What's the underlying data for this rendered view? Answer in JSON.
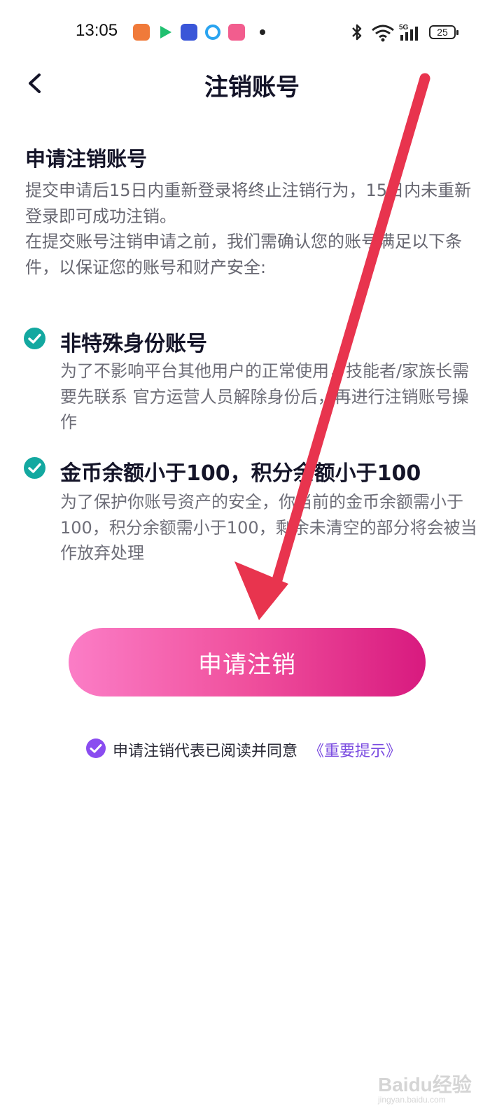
{
  "status_bar": {
    "time": "13:05",
    "app_icons": [
      {
        "name": "game-icon",
        "color": "#f07a3a"
      },
      {
        "name": "video-play-icon",
        "color": "#20c070"
      },
      {
        "name": "finance-app-icon",
        "color": "#3a56d8"
      },
      {
        "name": "browser-app-icon",
        "color": "#2aa4f0"
      },
      {
        "name": "bilibili-icon",
        "color": "#f25d8e"
      }
    ],
    "network": "5G",
    "battery": "25"
  },
  "nav": {
    "title": "注销账号"
  },
  "intro": {
    "heading": "申请注销账号",
    "paragraph_1": "提交申请后15日内重新登录将终止注销行为，15日内未重新登录即可成功注销。",
    "paragraph_2": "在提交账号注销申请之前，我们需确认您的账号满足以下条件，以保证您的账号和财产安全:"
  },
  "conditions": [
    {
      "title": "非特殊身份账号",
      "description": "为了不影响平台其他用户的正常使用，技能者/家族长需要先联系 官方运营人员解除身份后，再进行注销账号操作"
    },
    {
      "title": "金币余额小于100，积分余额小于100",
      "description": "为了保护你账号资产的安全，你当前的金币余额需小于100，积分余额需小于100，剩余未清空的部分将会被当作放弃处理"
    }
  ],
  "primary_action": {
    "label": "申请注销"
  },
  "agreement": {
    "text": "申请注销代表已阅读并同意",
    "link": "《重要提示》"
  },
  "colors": {
    "check_teal": "#13a8a0",
    "agree_purple": "#8a4cf0",
    "button_gradient_start": "#fb7dc6",
    "button_gradient_end": "#d81a7f",
    "annotation_arrow": "#e8344e"
  },
  "watermark": {
    "brand": "Baidu经验",
    "domain": "jingyan.baidu.com"
  }
}
